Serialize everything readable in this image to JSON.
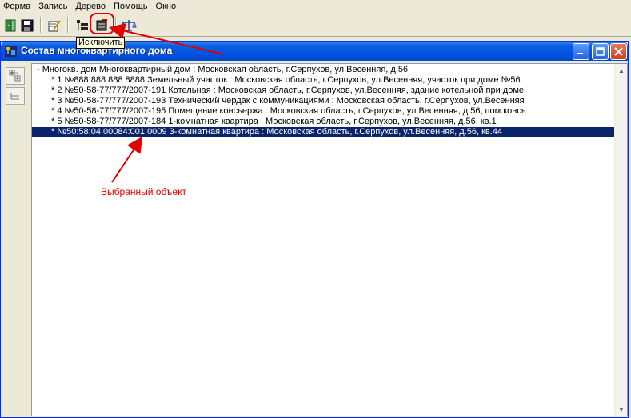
{
  "menu": [
    "Форма",
    "Запись",
    "Дерево",
    "Помощь",
    "Окно"
  ],
  "toolbar": {
    "buttons": [
      "exit-icon",
      "save-icon",
      "edit-icon",
      "include-icon",
      "exclude-icon",
      "scales-icon"
    ],
    "tooltip": "Исключить"
  },
  "window": {
    "title": "Состав многоквартирного дома"
  },
  "tree": {
    "root": "- Многокв. дом Многоквартирный дом : Московская область, г.Серпухов, ул.Весенняя, д.56",
    "items": [
      "* 1 №888 888 888 8888 Земельный участок : Московская область, г.Серпухов, ул.Весенняя, участок при доме №56",
      "* 2 №50-58-77/777/2007-191 Котельная : Московская область, г.Серпухов, ул.Весенняя, здание котельной при доме",
      "* 3 №50-58-77/777/2007-193 Технический чердак с коммуникациями : Московская область, г.Серпухов, ул.Весенняя",
      "* 4 №50-58-77/777/2007-195 Помещение консьержа : Московская область, г.Серпухов, ул.Весенняя, д.56, пом.консь",
      "* 5 №50-58-77/777/2007-184 1-комнатная квартира : Московская область, г.Серпухов, ул.Весенняя, д.56, кв.1",
      "*  №50:58:04:00084:001:0009 3-комнатная квартира : Московская область, г.Серпухов, ул.Весенняя, д.56, кв.44"
    ],
    "selected_index": 5
  },
  "annotation": "Выбранный объект",
  "colors": {
    "selection": "#0a246a",
    "annotation": "#e00000",
    "titlebar": "#0054e3"
  }
}
